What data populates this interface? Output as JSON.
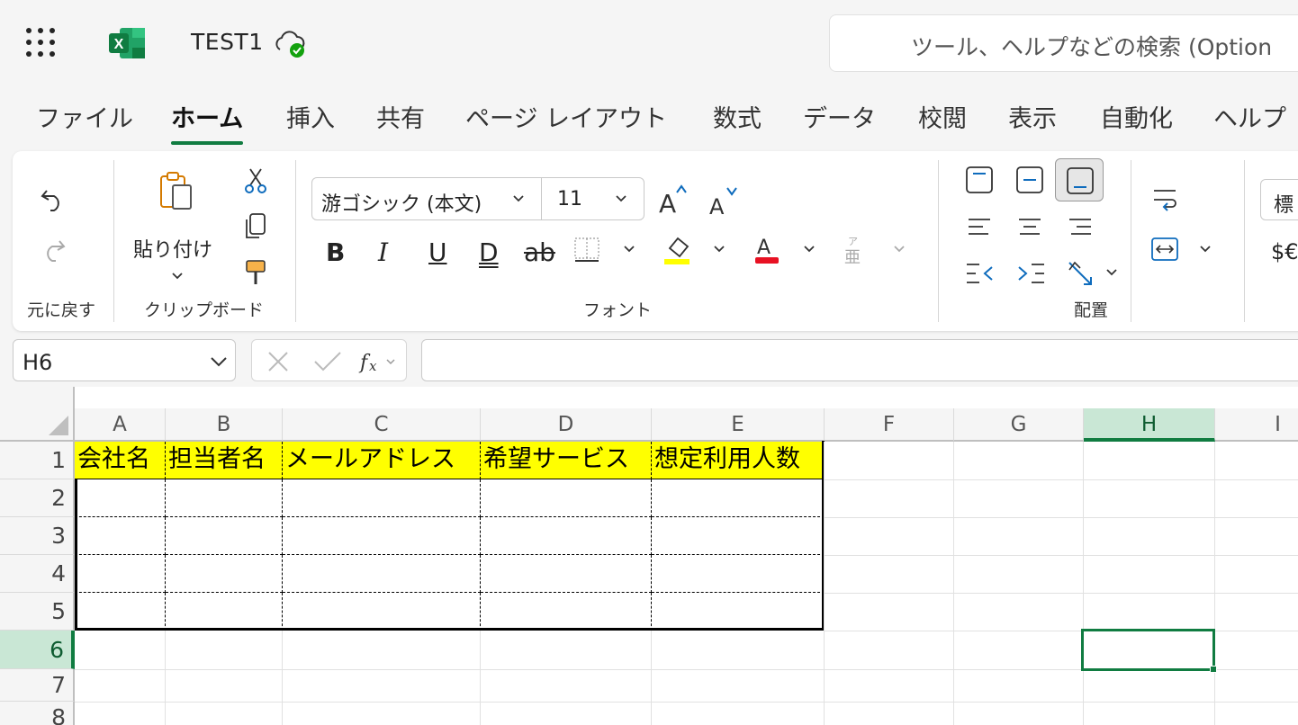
{
  "app": {
    "doc_title": "TEST1",
    "search_placeholder": "ツール、ヘルプなどの検索 (Option"
  },
  "tabs": [
    "ファイル",
    "ホーム",
    "挿入",
    "共有",
    "ページ レイアウト",
    "数式",
    "データ",
    "校閲",
    "表示",
    "自動化",
    "ヘルプ"
  ],
  "active_tab": "ホーム",
  "ribbon": {
    "groups": {
      "undo": "元に戻す",
      "clipboard": "クリップボード",
      "font": "フォント",
      "alignment": "配置"
    },
    "paste_label": "貼り付け",
    "font_name": "游ゴシック (本文)",
    "font_size": "11",
    "bold": "B",
    "italic": "I",
    "underline": "U",
    "double_underline": "D",
    "strikethrough": "ab",
    "number_format": "標",
    "currency": "$€",
    "font_color": "#e81123",
    "fill_color": "#ffff00"
  },
  "formula_bar": {
    "name_box": "H6",
    "formula": ""
  },
  "grid": {
    "columns": [
      "A",
      "B",
      "C",
      "D",
      "E",
      "F",
      "G",
      "H",
      "I"
    ],
    "rows": [
      "1",
      "2",
      "3",
      "4",
      "5",
      "6",
      "7",
      "8"
    ],
    "selected_column": "H",
    "selected_row": "6",
    "header_cells": [
      "会社名",
      "担当者名",
      "メールアドレス",
      "希望サービス",
      "想定利用人数"
    ],
    "accent": "#107c41"
  }
}
